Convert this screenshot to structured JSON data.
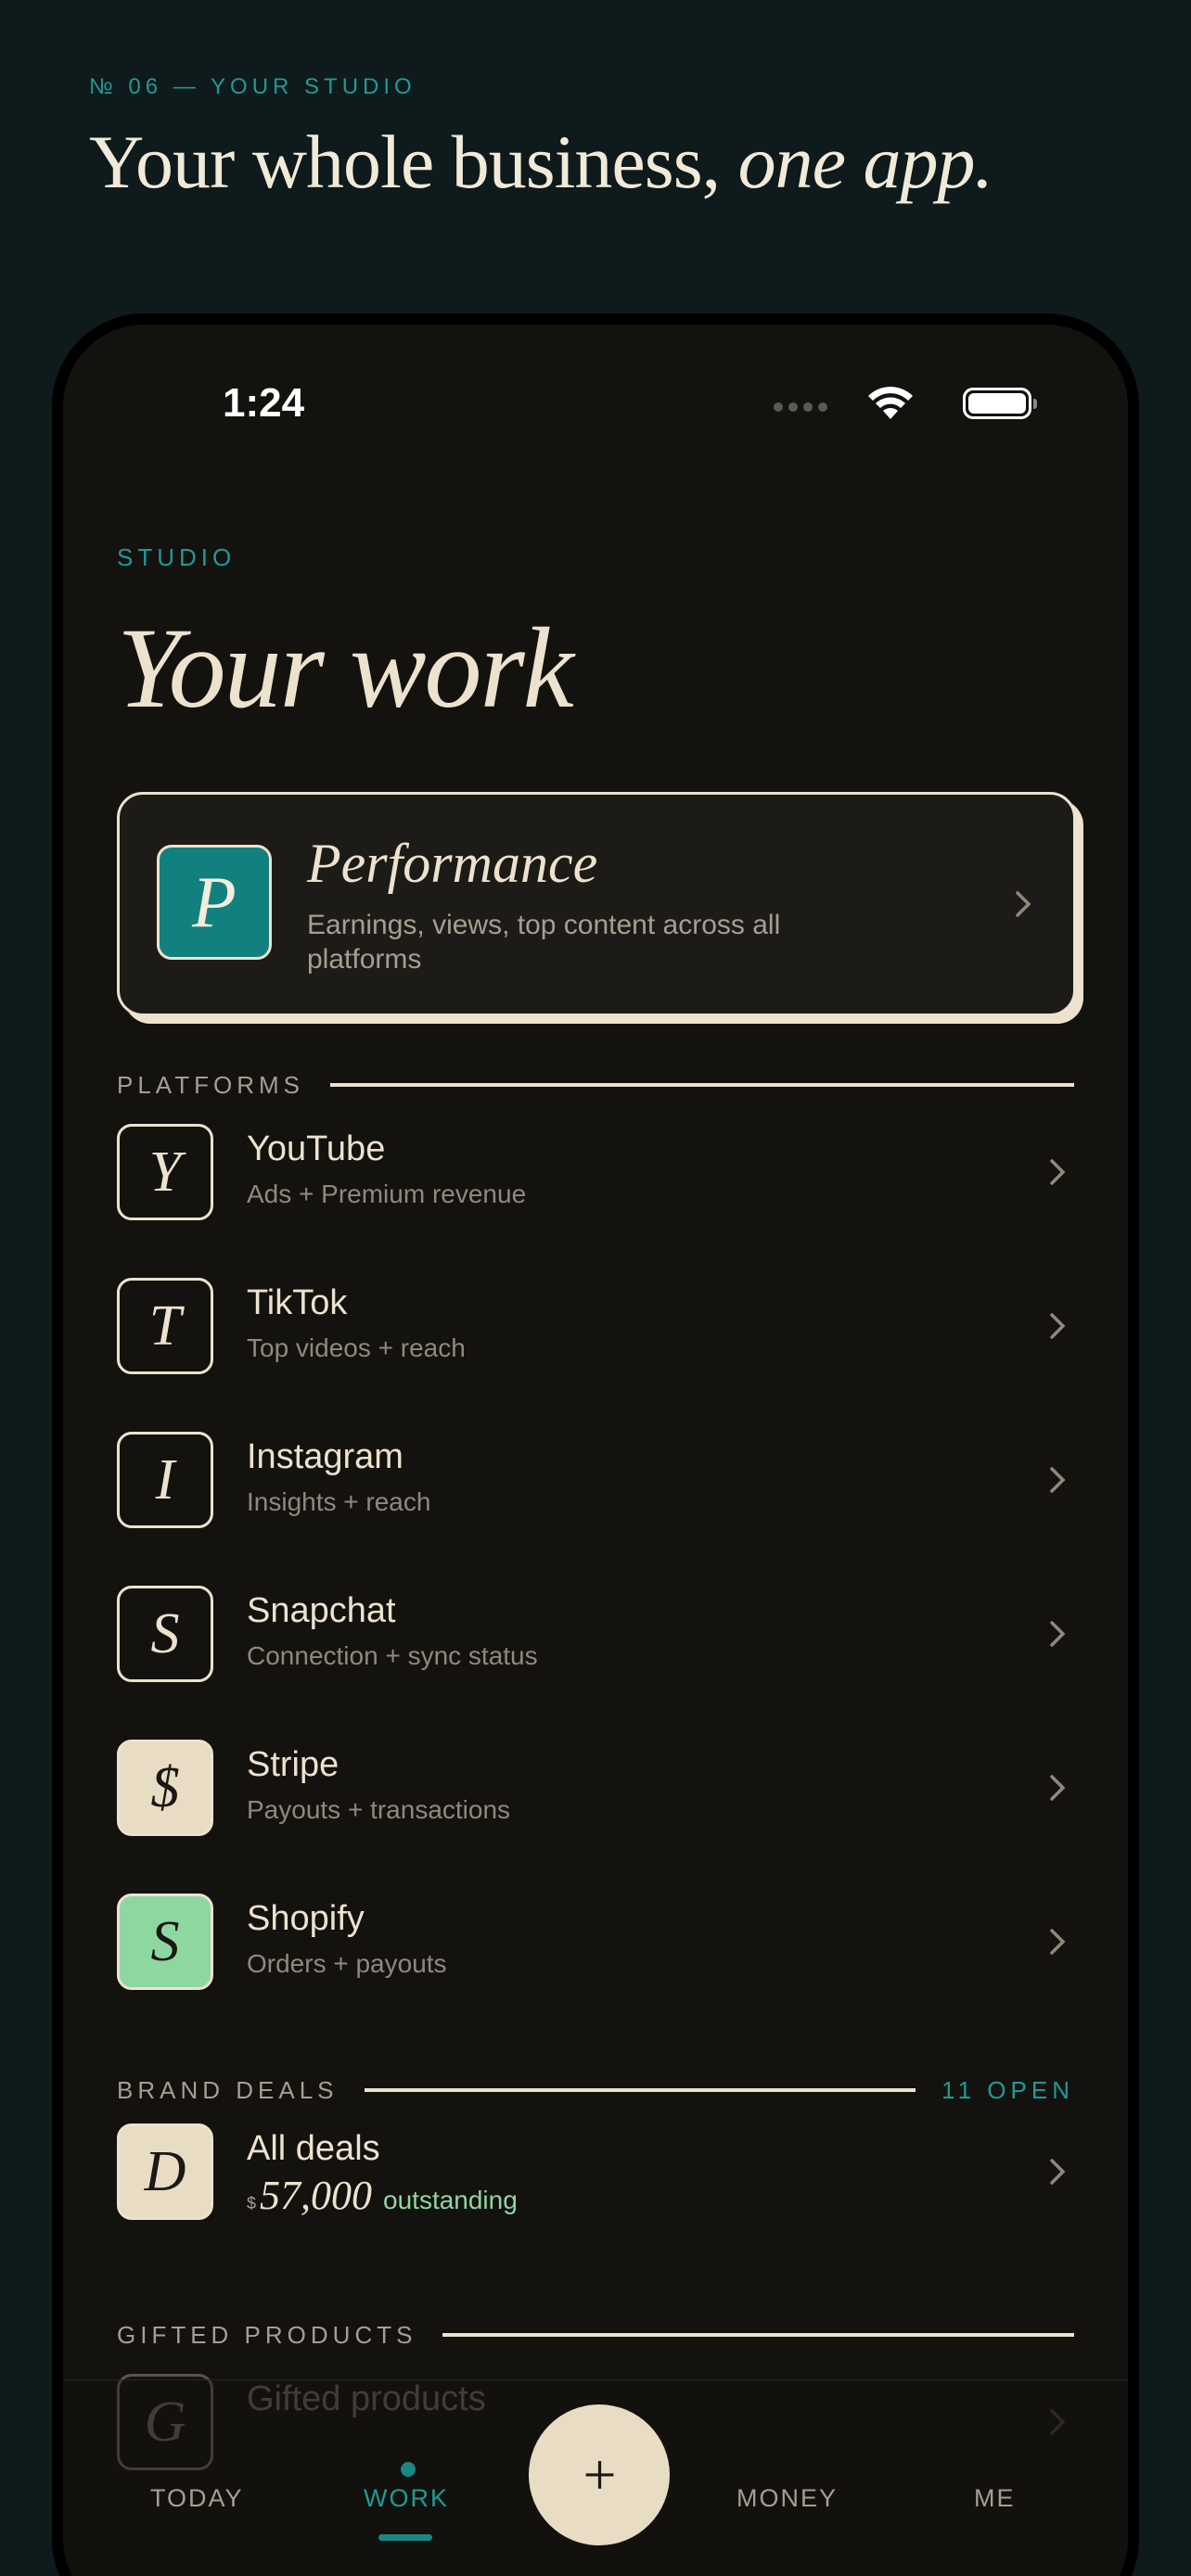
{
  "header": {
    "eyebrow": "№ 06 — YOUR STUDIO",
    "headline_main": "Your whole business,",
    "headline_italic": "one app."
  },
  "status_bar": {
    "time": "1:24"
  },
  "screen": {
    "section_label": "STUDIO",
    "title": "Your work"
  },
  "performance": {
    "tile_letter": "P",
    "title": "Performance",
    "description": "Earnings, views, top content across all platforms"
  },
  "platforms": {
    "label": "PLATFORMS",
    "items": [
      {
        "letter": "Y",
        "title": "YouTube",
        "subtitle": "Ads + Premium revenue"
      },
      {
        "letter": "T",
        "title": "TikTok",
        "subtitle": "Top videos + reach"
      },
      {
        "letter": "I",
        "title": "Instagram",
        "subtitle": "Insights + reach"
      },
      {
        "letter": "S",
        "title": "Snapchat",
        "subtitle": "Connection + sync status"
      },
      {
        "letter": "$",
        "title": "Stripe",
        "subtitle": "Payouts + transactions"
      },
      {
        "letter": "S",
        "title": "Shopify",
        "subtitle": "Orders + payouts"
      }
    ]
  },
  "brand_deals": {
    "label": "BRAND DEALS",
    "count": "11 OPEN",
    "item": {
      "letter": "D",
      "title": "All deals",
      "currency": "$",
      "amount": "57,000",
      "status": "outstanding"
    }
  },
  "gifted": {
    "label": "GIFTED PRODUCTS",
    "item": {
      "letter": "G",
      "title": "Gifted products"
    }
  },
  "tabbar": {
    "today": "TODAY",
    "work": "WORK",
    "fab": "+",
    "money": "MONEY",
    "me": "ME"
  },
  "colors": {
    "page_background": "#0e1a1b",
    "screen_background": "#13120f",
    "accent_teal": "#1f9a97",
    "cream": "#ece2cd",
    "shopify_green": "#8fd7a1"
  }
}
